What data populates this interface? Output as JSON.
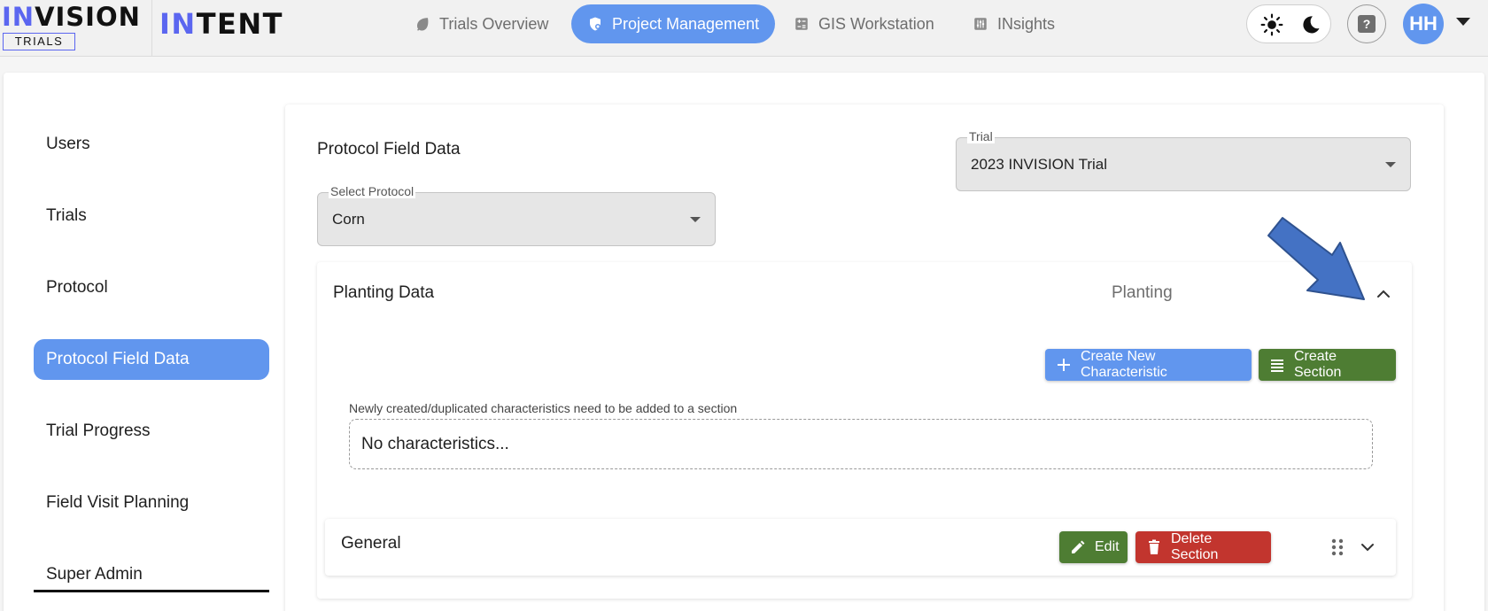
{
  "brand": {
    "logo_highlight": "IN",
    "logo_rest": "VISION",
    "logo_sub": "TRIALS",
    "product_highlight": "IN",
    "product_rest": "TENT"
  },
  "nav": {
    "tabs": [
      {
        "label": "Trials Overview",
        "icon": "leaf-icon"
      },
      {
        "label": "Project Management",
        "icon": "shield-gear-icon",
        "active": true
      },
      {
        "label": "GIS Workstation",
        "icon": "calculator-icon"
      },
      {
        "label": "INsights",
        "icon": "sliders-icon"
      }
    ],
    "avatar_initials": "HH",
    "help_symbol": "?"
  },
  "sidebar": {
    "items": [
      {
        "label": "Users"
      },
      {
        "label": "Trials"
      },
      {
        "label": "Protocol"
      },
      {
        "label": "Protocol Field Data",
        "active": true
      },
      {
        "label": "Trial Progress"
      },
      {
        "label": "Field Visit Planning"
      },
      {
        "label": "Super Admin"
      }
    ]
  },
  "main": {
    "title": "Protocol Field Data",
    "trial_select": {
      "label": "Trial",
      "value": "2023 INVISION Trial"
    },
    "protocol_select": {
      "label": "Select Protocol",
      "value": "Corn"
    },
    "accordion": {
      "title": "Planting Data",
      "type": "Planting",
      "create_characteristic_label": "Create New Characteristic",
      "create_section_label": "Create Section",
      "helper_text": "Newly created/duplicated characteristics need to be added to a section",
      "empty_text": "No characteristics...",
      "section": {
        "title": "General",
        "edit_label": "Edit",
        "delete_label": "Delete Section"
      }
    }
  },
  "colors": {
    "accent": "#6196ee",
    "brand_accent": "#5b66f0",
    "success": "#4e7d33",
    "danger": "#c2352e",
    "annotation_arrow": "#4472c4"
  }
}
